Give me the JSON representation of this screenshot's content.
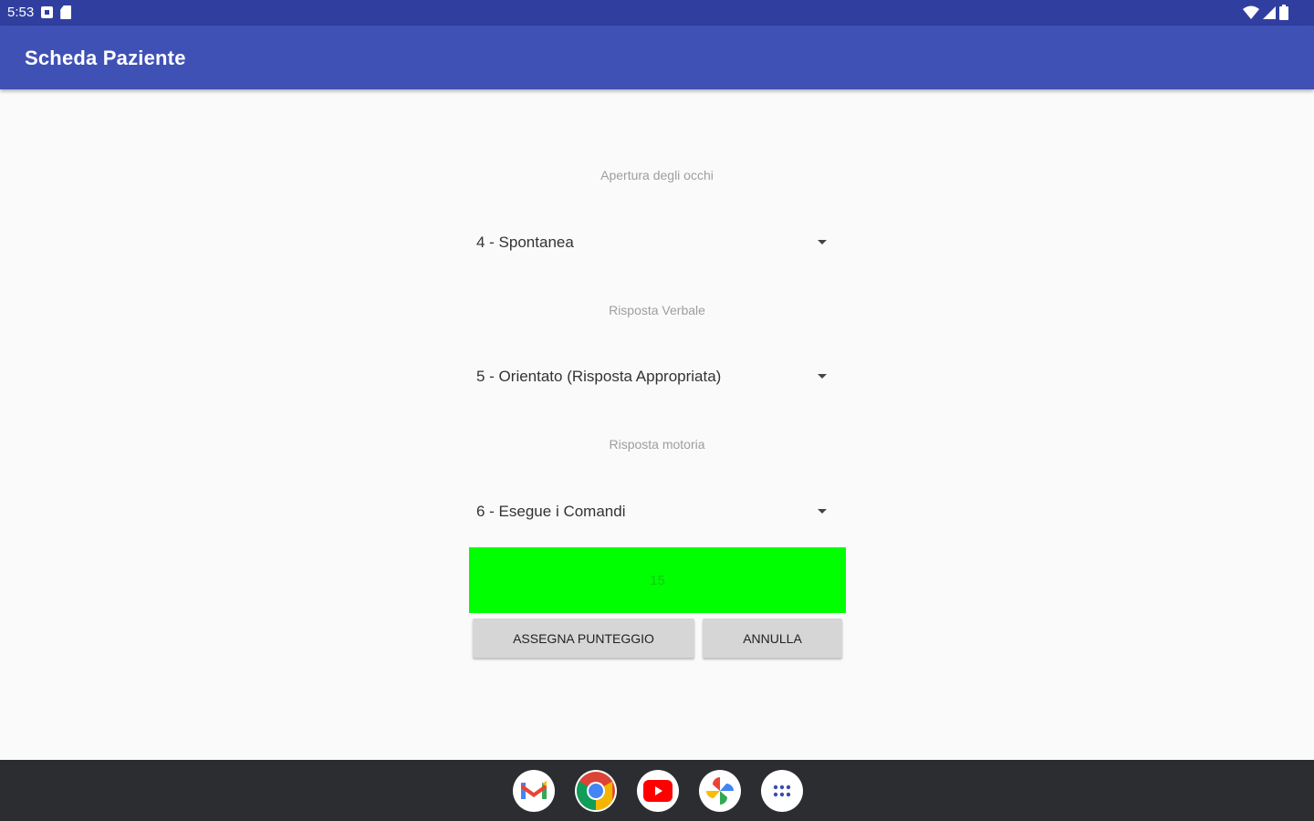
{
  "status_bar": {
    "time": "5:53"
  },
  "app_bar": {
    "title": "Scheda Paziente"
  },
  "form": {
    "eye_opening": {
      "label": "Apertura degli occhi",
      "value": "4 - Spontanea"
    },
    "verbal_response": {
      "label": "Risposta Verbale",
      "value": "5 - Orientato (Risposta Appropriata)"
    },
    "motor_response": {
      "label": "Risposta motoria",
      "value": "6 - Esegue i Comandi"
    }
  },
  "score": {
    "value": "15",
    "color": "#00ff00"
  },
  "buttons": {
    "assign": "ASSEGNA PUNTEGGIO",
    "cancel": "ANNULLA"
  },
  "dock": {
    "apps": [
      "gmail-icon",
      "chrome-icon",
      "youtube-icon",
      "photos-icon",
      "app-drawer-icon"
    ]
  },
  "colors": {
    "status_bar": "#303f9f",
    "app_bar": "#3f51b5",
    "nav_bar": "#2b2d30"
  }
}
